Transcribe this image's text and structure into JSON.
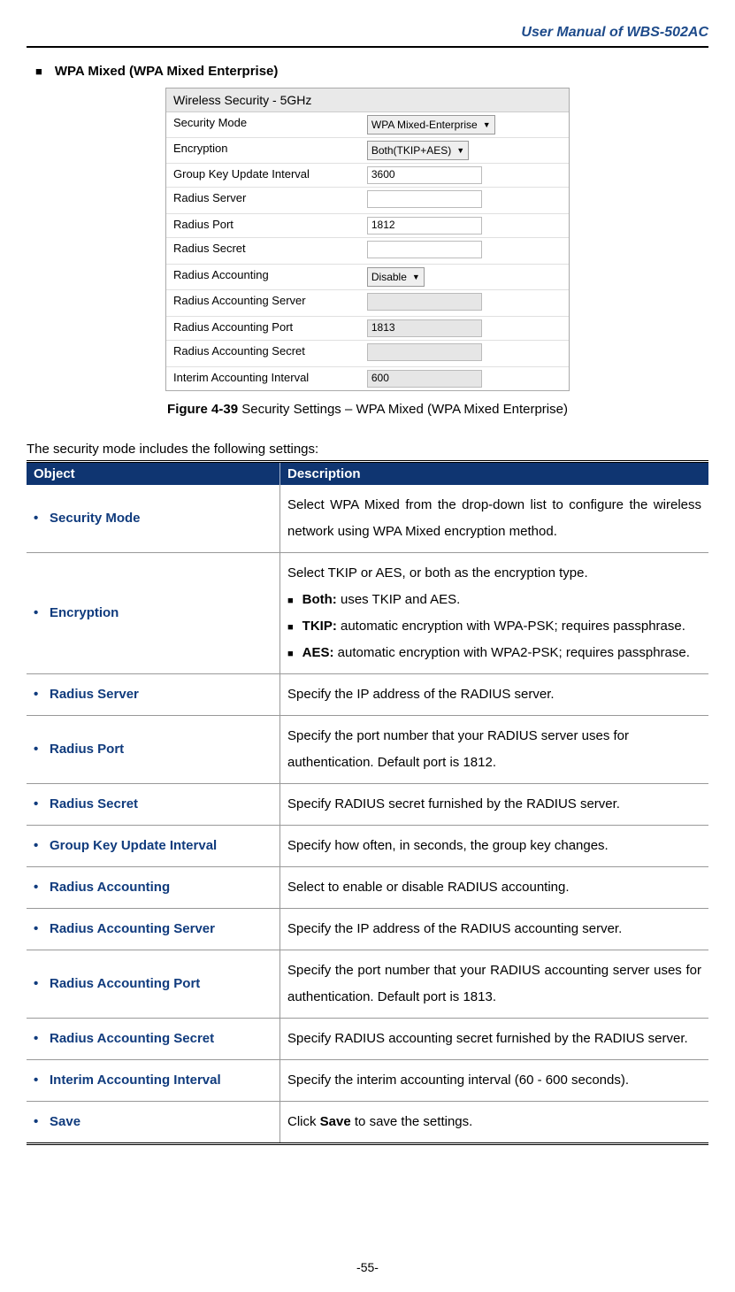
{
  "header": "User Manual of WBS-502AC",
  "sectionTitle": "WPA Mixed (WPA Mixed Enterprise)",
  "fig": {
    "title": "Wireless Security - 5GHz",
    "rows": [
      {
        "label": "Security Mode",
        "type": "select",
        "value": "WPA Mixed-Enterprise"
      },
      {
        "label": "Encryption",
        "type": "select",
        "value": "Both(TKIP+AES)"
      },
      {
        "label": "Group Key Update Interval",
        "type": "input",
        "value": "3600"
      },
      {
        "label": "Radius Server",
        "type": "input",
        "value": ""
      },
      {
        "label": "Radius Port",
        "type": "input",
        "value": "1812"
      },
      {
        "label": "Radius Secret",
        "type": "input",
        "value": ""
      },
      {
        "label": "Radius Accounting",
        "type": "select",
        "value": "Disable"
      },
      {
        "label": "Radius Accounting Server",
        "type": "input-dis",
        "value": ""
      },
      {
        "label": "Radius Accounting Port",
        "type": "input-dis",
        "value": "1813"
      },
      {
        "label": "Radius Accounting Secret",
        "type": "input-dis",
        "value": ""
      },
      {
        "label": "Interim Accounting Interval",
        "type": "input-dis",
        "value": "600"
      }
    ]
  },
  "captionBold": "Figure 4-39",
  "captionRest": " Security Settings – WPA Mixed (WPA Mixed Enterprise)",
  "intro": "The security mode includes the following settings:",
  "th1": "Object",
  "th2": "Description",
  "rows": [
    {
      "obj": "Security Mode",
      "desc": "Select WPA Mixed from the drop-down list to configure the wireless network using WPA Mixed encryption method.",
      "justify": true
    },
    {
      "obj": "Encryption",
      "desc_html": true,
      "intro": "Select TKIP or AES, or both as the encryption type.",
      "b1b": "Both:",
      "b1": " uses TKIP and AES.",
      "b2b": "TKIP:",
      "b2": " automatic encryption with WPA-PSK; requires passphrase.",
      "b3b": "AES:",
      "b3": " automatic encryption with WPA2-PSK; requires passphrase."
    },
    {
      "obj": "Radius Server",
      "desc": "Specify the IP address of the RADIUS server."
    },
    {
      "obj": "Radius Port",
      "desc": "Specify the port number that your RADIUS server uses for authentication. Default port is 1812."
    },
    {
      "obj": "Radius Secret",
      "desc": "Specify RADIUS secret furnished by the RADIUS server."
    },
    {
      "obj": "Group Key Update Interval",
      "desc": "Specify how often, in seconds, the group key changes."
    },
    {
      "obj": "Radius Accounting",
      "desc": "Select to enable or disable RADIUS accounting."
    },
    {
      "obj": "Radius Accounting Server",
      "desc": "Specify the IP address of the RADIUS accounting server."
    },
    {
      "obj": "Radius Accounting Port",
      "desc": "Specify the port number that your RADIUS accounting server uses for authentication. Default port is 1813.",
      "justify": true
    },
    {
      "obj": "Radius Accounting Secret",
      "desc": "Specify RADIUS accounting secret furnished by the RADIUS server."
    },
    {
      "obj": "Interim Accounting Interval",
      "desc": "Specify the interim accounting interval (60 - 600 seconds)."
    },
    {
      "obj": "Save",
      "desc_save": true,
      "pre": "Click ",
      "bold": "Save",
      "post": " to save the settings."
    }
  ],
  "footer": "-55-"
}
